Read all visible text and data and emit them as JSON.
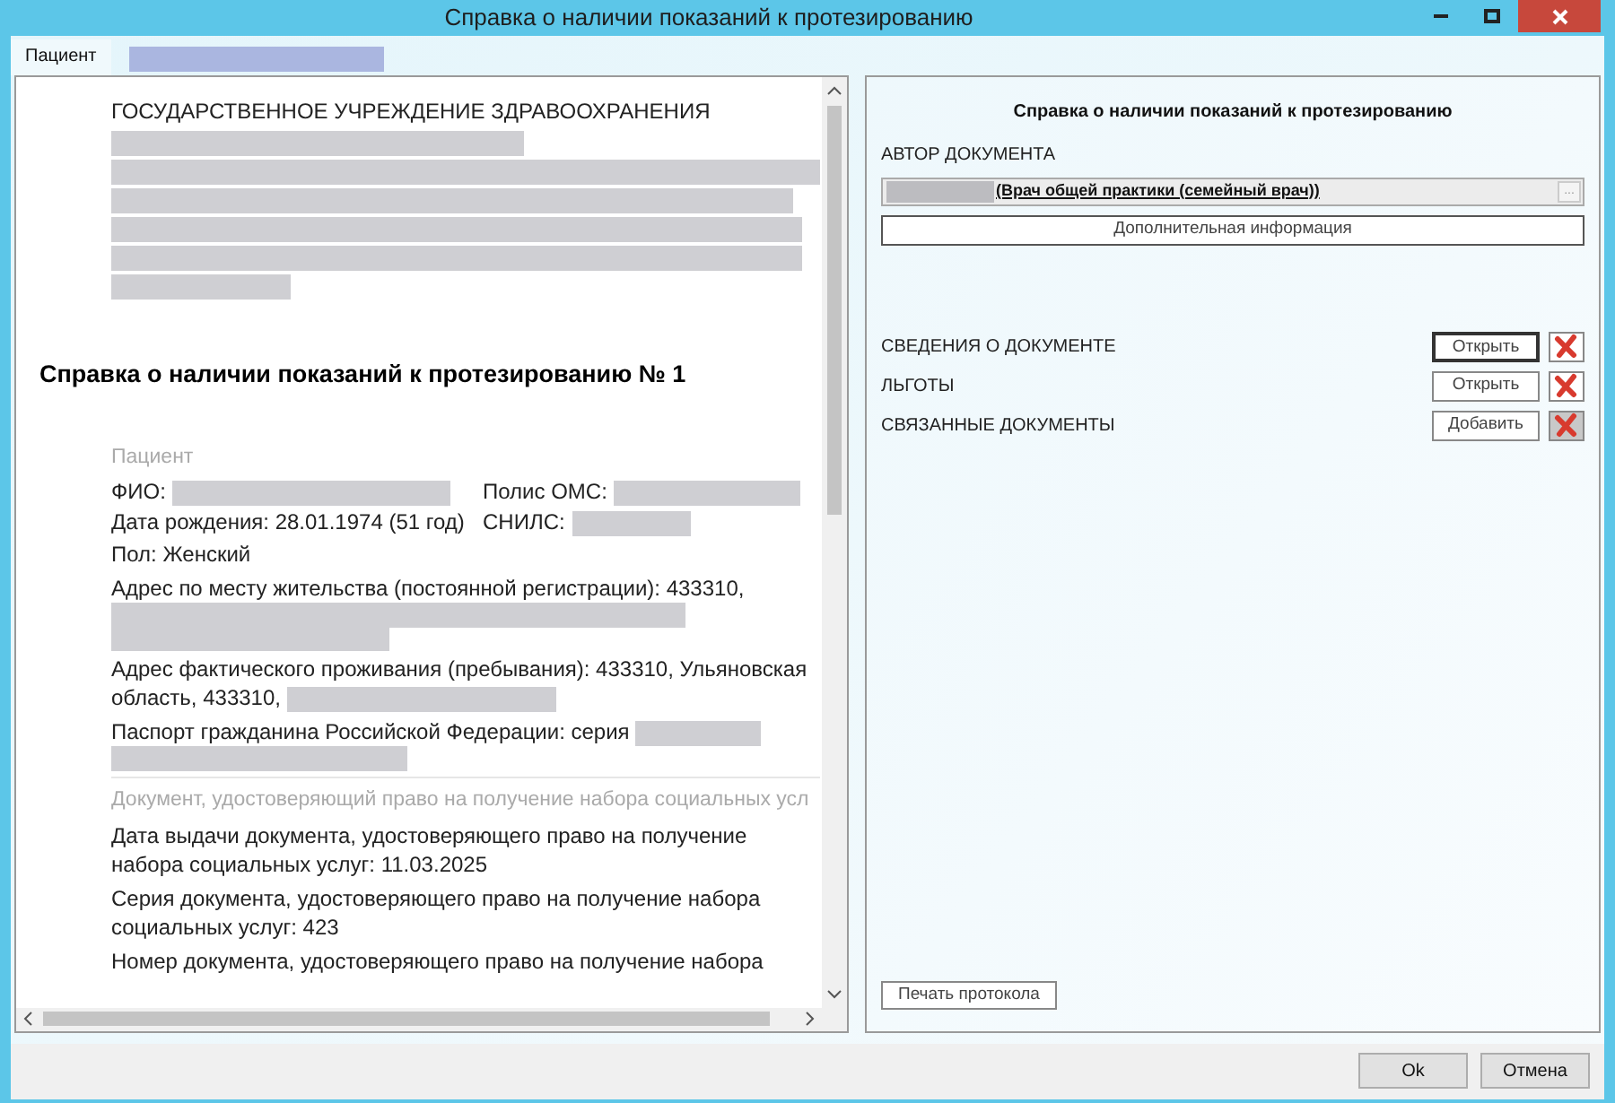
{
  "window": {
    "title": "Справка о наличии показаний к протезированию"
  },
  "tabs": [
    {
      "label": "Пациент",
      "selected": true
    }
  ],
  "document": {
    "org": "ГОСУДАРСТВЕННОЕ УЧРЕЖДЕНИЕ ЗДРАВООХРАНЕНИЯ",
    "title": "Справка о наличии показаний к протезированию № 1",
    "sections": [
      {
        "heading": "Пациент",
        "blocks": [
          {
            "kind": "pair",
            "items": [
              {
                "label": "ФИО:"
              },
              {
                "label": "Полис ОМС:"
              }
            ]
          },
          {
            "kind": "pair",
            "items": [
              {
                "label": "Дата рождения: 28.01.1974 (51 год)"
              },
              {
                "label": "СНИЛС:"
              }
            ]
          },
          {
            "kind": "text",
            "text": "Пол: Женский"
          },
          {
            "kind": "text",
            "text": "Адрес по месту жительства (постоянной регистрации): 433310,"
          },
          {
            "kind": "text",
            "text": "Адрес фактического проживания (пребывания): 433310, Ульяновская область, 433310,"
          },
          {
            "kind": "text",
            "text": "Паспорт гражданина Российской Федерации: серия"
          }
        ]
      },
      {
        "heading": "Документ, удостоверяющий право на получение набора социальных усл",
        "blocks": [
          {
            "kind": "text",
            "text": "Дата выдачи документа, удостоверяющего право на получение набора социальных услуг: 11.03.2025"
          },
          {
            "kind": "text",
            "text": "Серия документа, удостоверяющего право на получение набора социальных услуг: 423"
          },
          {
            "kind": "text",
            "text": "Номер документа, удостоверяющего право на получение набора"
          }
        ]
      }
    ]
  },
  "panel": {
    "title": "Справка о наличии показаний к протезированию",
    "author_label": "АВТОР ДОКУМЕНТА",
    "author_value": "(Врач общей практики (семейный врач))",
    "author_button": "...",
    "info_button": "Дополнительная информация",
    "rows": [
      {
        "label": "СВЕДЕНИЯ О ДОКУМЕНТЕ",
        "button": "Открыть",
        "focused": true,
        "delete_disabled": false
      },
      {
        "label": "ЛЬГОТЫ",
        "button": "Открыть",
        "focused": false,
        "delete_disabled": false
      },
      {
        "label": "СВЯЗАННЫЕ ДОКУМЕНТЫ",
        "button": "Добавить",
        "focused": false,
        "delete_disabled": true
      }
    ],
    "print_button": "Печать протокола"
  },
  "buttons": [
    {
      "label": "Ok"
    },
    {
      "label": "Отмена"
    }
  ]
}
